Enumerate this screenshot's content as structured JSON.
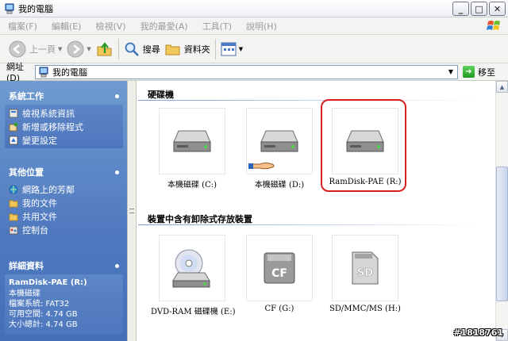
{
  "window": {
    "title": "我的電腦"
  },
  "window_buttons": {
    "minimize": "_",
    "maximize": "□",
    "close": "✕"
  },
  "menu": [
    "檔案(F)",
    "編輯(E)",
    "檢視(V)",
    "我的最愛(A)",
    "工具(T)",
    "說明(H)"
  ],
  "toolbar": {
    "back": "上一頁",
    "search": "搜尋",
    "folders": "資料夾"
  },
  "address": {
    "label": "網址(D)",
    "value": "我的電腦",
    "go": "移至"
  },
  "sidebar": {
    "system_tasks": {
      "title": "系統工作",
      "items": [
        "檢視系統資訊",
        "新增或移除程式",
        "變更設定"
      ]
    },
    "other_places": {
      "title": "其他位置",
      "items": [
        "網路上的芳鄰",
        "我的文件",
        "共用文件",
        "控制台"
      ]
    },
    "details": {
      "title": "詳細資料",
      "name": "RamDisk-PAE (R:)",
      "type": "本機磁碟",
      "filesystem": "檔案系統: FAT32",
      "free": "可用空間: 4.74 GB",
      "total": "大小總計: 4.74 GB"
    }
  },
  "groups": {
    "hard_disks": {
      "title": "硬碟機",
      "items": [
        "本機磁碟 (C:)",
        "本機磁碟 (D:)",
        "RamDisk-PAE (R:)"
      ]
    },
    "removable": {
      "title": "裝置中含有卸除式存放裝置",
      "items": [
        "DVD-RAM 磁碟機 (E:)",
        "CF (G:)",
        "SD/MMC/MS (H:)"
      ]
    }
  },
  "card_labels": {
    "cf": "CF",
    "sd": "SD"
  },
  "watermark": "#1818761",
  "colors": {
    "highlight": "#d81e1e",
    "sidebar": "#5d86c6",
    "go": "#1f9a1f"
  }
}
